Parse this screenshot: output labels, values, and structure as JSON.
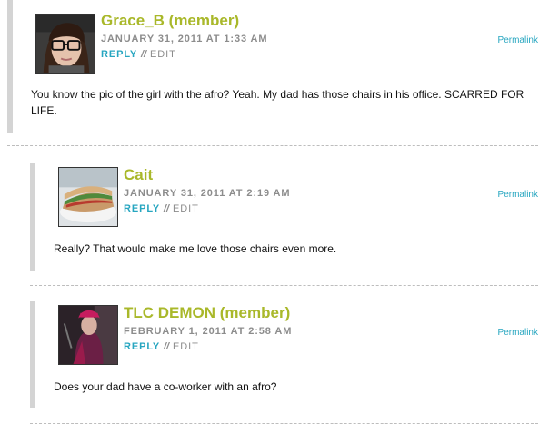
{
  "comments": [
    {
      "author": "Grace_B (member)",
      "date": "JANUARY 31, 2011 AT 1:33 AM",
      "reply_label": "REPLY",
      "separator": "//",
      "edit_label": "EDIT",
      "permalink_label": "Permalink",
      "text": "You know the pic of the girl with the afro? Yeah. My dad has those chairs in his office. SCARRED FOR LIFE.",
      "avatar_icon": "avatar-photo-grace"
    },
    {
      "author": "Cait",
      "date": "JANUARY 31, 2011 AT 2:19 AM",
      "reply_label": "REPLY",
      "separator": "//",
      "edit_label": "EDIT",
      "permalink_label": "Permalink",
      "text": "Really? That would make me love those chairs even more.",
      "avatar_icon": "avatar-photo-sandwich"
    },
    {
      "author": "TLC DEMON (member)",
      "date": "FEBRUARY 1, 2011 AT 2:58 AM",
      "reply_label": "REPLY",
      "separator": "//",
      "edit_label": "EDIT",
      "permalink_label": "Permalink",
      "text": "Does your dad have a co-worker with an afro?",
      "avatar_icon": "avatar-photo-demon"
    }
  ],
  "colors": {
    "author": "#a9b82a",
    "reply": "#27a6c0",
    "meta": "#8c8c8c",
    "bar": "#d4d4d4"
  }
}
